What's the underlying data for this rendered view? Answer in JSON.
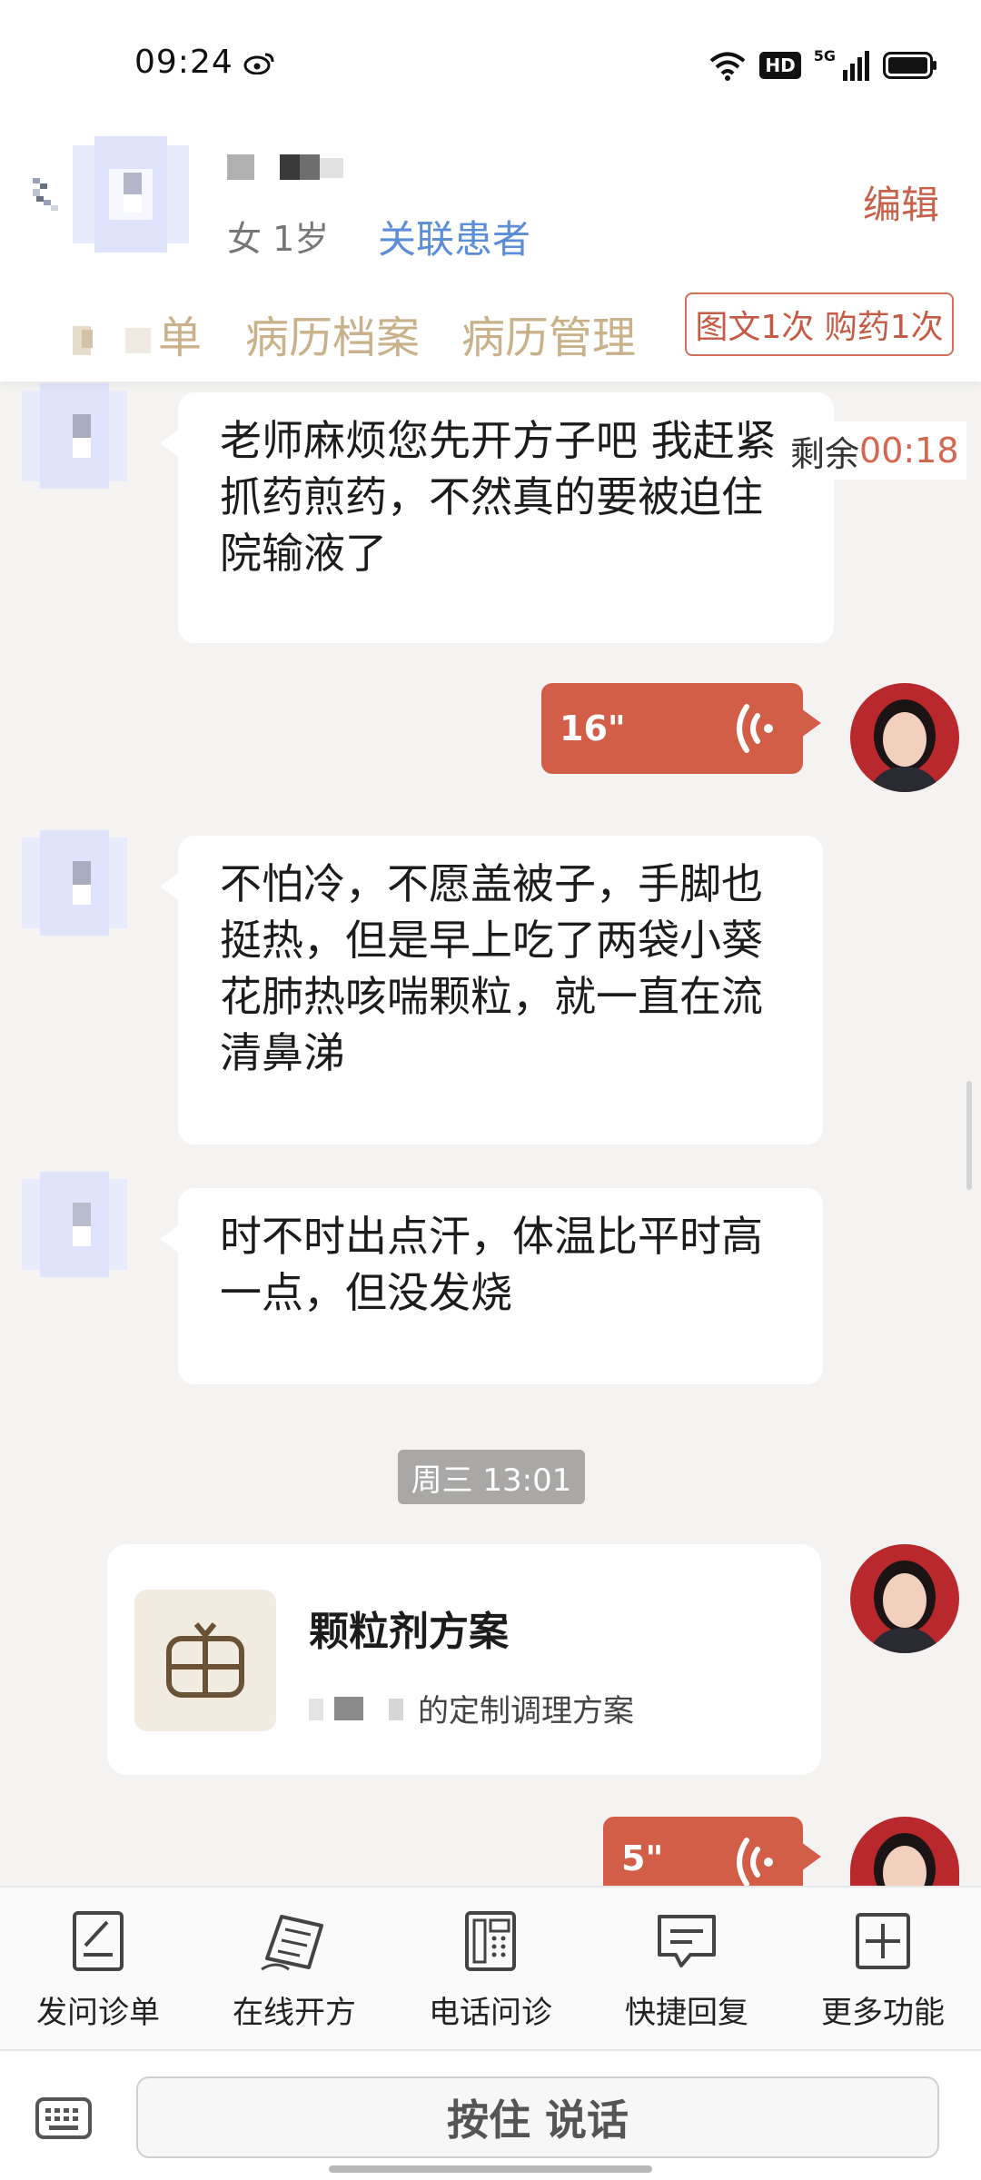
{
  "status_bar": {
    "time": "09:24",
    "hd_label": "HD",
    "network_label": "5G",
    "icons": [
      "weibo-icon",
      "wifi-icon",
      "signal-icon",
      "battery-icon"
    ]
  },
  "header": {
    "patient_meta": "女 1岁",
    "link_label": "关联患者",
    "edit_label": "编辑",
    "tabs": [
      {
        "label": "单"
      },
      {
        "label": "病历档案"
      },
      {
        "label": "病历管理"
      }
    ],
    "counter_badge": "图文1次 购药1次"
  },
  "timer": {
    "label": "剩余",
    "value": "00:18"
  },
  "messages": [
    {
      "type": "text",
      "from": "patient",
      "text": "老师麻烦您先开方子吧 我赶紧抓药煎药，不然真的要被迫住院输液了"
    },
    {
      "type": "voice",
      "from": "doctor",
      "duration": "16\""
    },
    {
      "type": "text",
      "from": "patient",
      "text": "不怕冷，不愿盖被子，手脚也挺热，但是早上吃了两袋小葵花肺热咳喘颗粒，就一直在流清鼻涕"
    },
    {
      "type": "text",
      "from": "patient",
      "text": "时不时出点汗，体温比平时高一点，但没发烧"
    },
    {
      "type": "timestamp",
      "text": "周三 13:01"
    },
    {
      "type": "card",
      "from": "doctor",
      "title": "颗粒剂方案",
      "subtitle": "的定制调理方案"
    },
    {
      "type": "voice",
      "from": "doctor",
      "duration": "5\""
    }
  ],
  "toolbar": {
    "items": [
      {
        "label": "发问诊单",
        "icon": "form-icon"
      },
      {
        "label": "在线开方",
        "icon": "prescription-icon"
      },
      {
        "label": "电话问诊",
        "icon": "phone-icon"
      },
      {
        "label": "快捷回复",
        "icon": "message-icon"
      },
      {
        "label": "更多功能",
        "icon": "plus-square-icon"
      }
    ]
  },
  "input": {
    "hold_to_talk": "按住 说话"
  },
  "colors": {
    "accent": "#d35e47",
    "link": "#5b8ed6",
    "tab_text": "#c9b189",
    "background": "#f4f3f1"
  }
}
